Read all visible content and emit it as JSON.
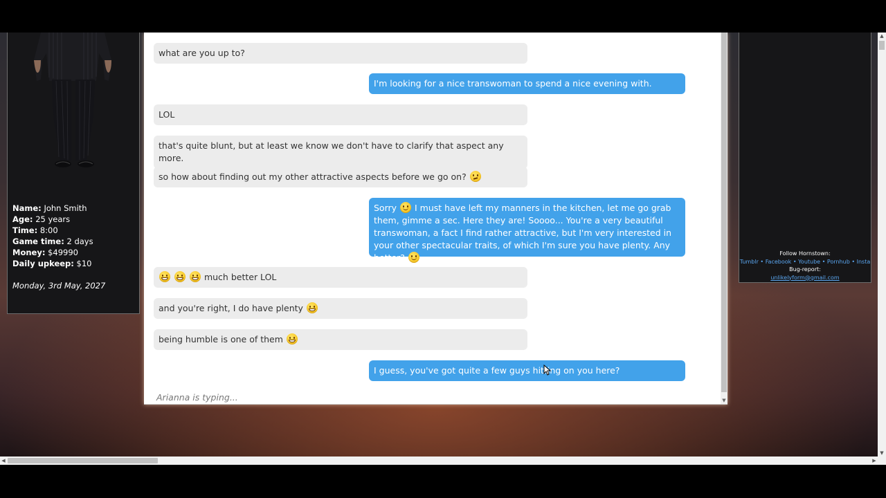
{
  "player": {
    "name_label": "Name:",
    "name": "John Smith",
    "age_label": "Age:",
    "age": "25 years",
    "time_label": "Time:",
    "time": "8:00",
    "game_time_label": "Game time:",
    "game_time": "2 days",
    "money_label": "Money:",
    "money": "$49990",
    "upkeep_label": "Daily upkeep:",
    "upkeep": "$10",
    "date": "Monday, 3rd May, 2027"
  },
  "right_panel": {
    "follow": "Follow Hornstown:",
    "links": [
      "Tumblr",
      "Facebook",
      "Youtube",
      "Pornhub",
      "Insta"
    ],
    "separator": "•",
    "bug_report": "Bug-report:",
    "email": "unlikelyform@gmail.com"
  },
  "chat": {
    "messages": [
      {
        "dir": "in",
        "text": "what are you up to?"
      },
      {
        "dir": "out",
        "text": "I'm looking for a nice transwoman to spend a nice evening with."
      },
      {
        "dir": "in",
        "text": "LOL"
      },
      {
        "dir": "in",
        "text": "that's quite blunt, but at least we know we don't have to clarify that aspect any more."
      },
      {
        "dir": "in",
        "text": "so how about finding out my other attractive aspects before we go on?",
        "emoji_after": "think"
      },
      {
        "dir": "out",
        "text_a": "Sorry",
        "emoji_mid": "smile",
        "text_b": " I must have left my manners in the kitchen, let me go grab them, gimme a sec. Here they are! Soooo... You're a very beautiful transwoman, a fact I find rather attractive, but I'm very interested in your other spectacular traits, of which I'm sure you have plenty. Any better?",
        "emoji_after": "smile"
      },
      {
        "dir": "in",
        "emoji_before": [
          "grin",
          "grin",
          "grin"
        ],
        "text": "much better LOL"
      },
      {
        "dir": "in",
        "text": "and you're right, I do have plenty",
        "emoji_after": "grin"
      },
      {
        "dir": "in",
        "text": "being humble is one of them",
        "emoji_after": "grin"
      },
      {
        "dir": "out",
        "text": "I guess, you've got quite a few guys hitting on you here?"
      }
    ],
    "typing": "Arianna is typing..."
  },
  "colors": {
    "incoming_bubble": "#ececec",
    "outgoing_bubble": "#42a2ea",
    "link": "#5aa6f0"
  },
  "icons": {
    "emoji_grin": "grinning-face-icon",
    "emoji_smile": "smiling-face-icon",
    "emoji_think": "thinking-face-icon"
  }
}
